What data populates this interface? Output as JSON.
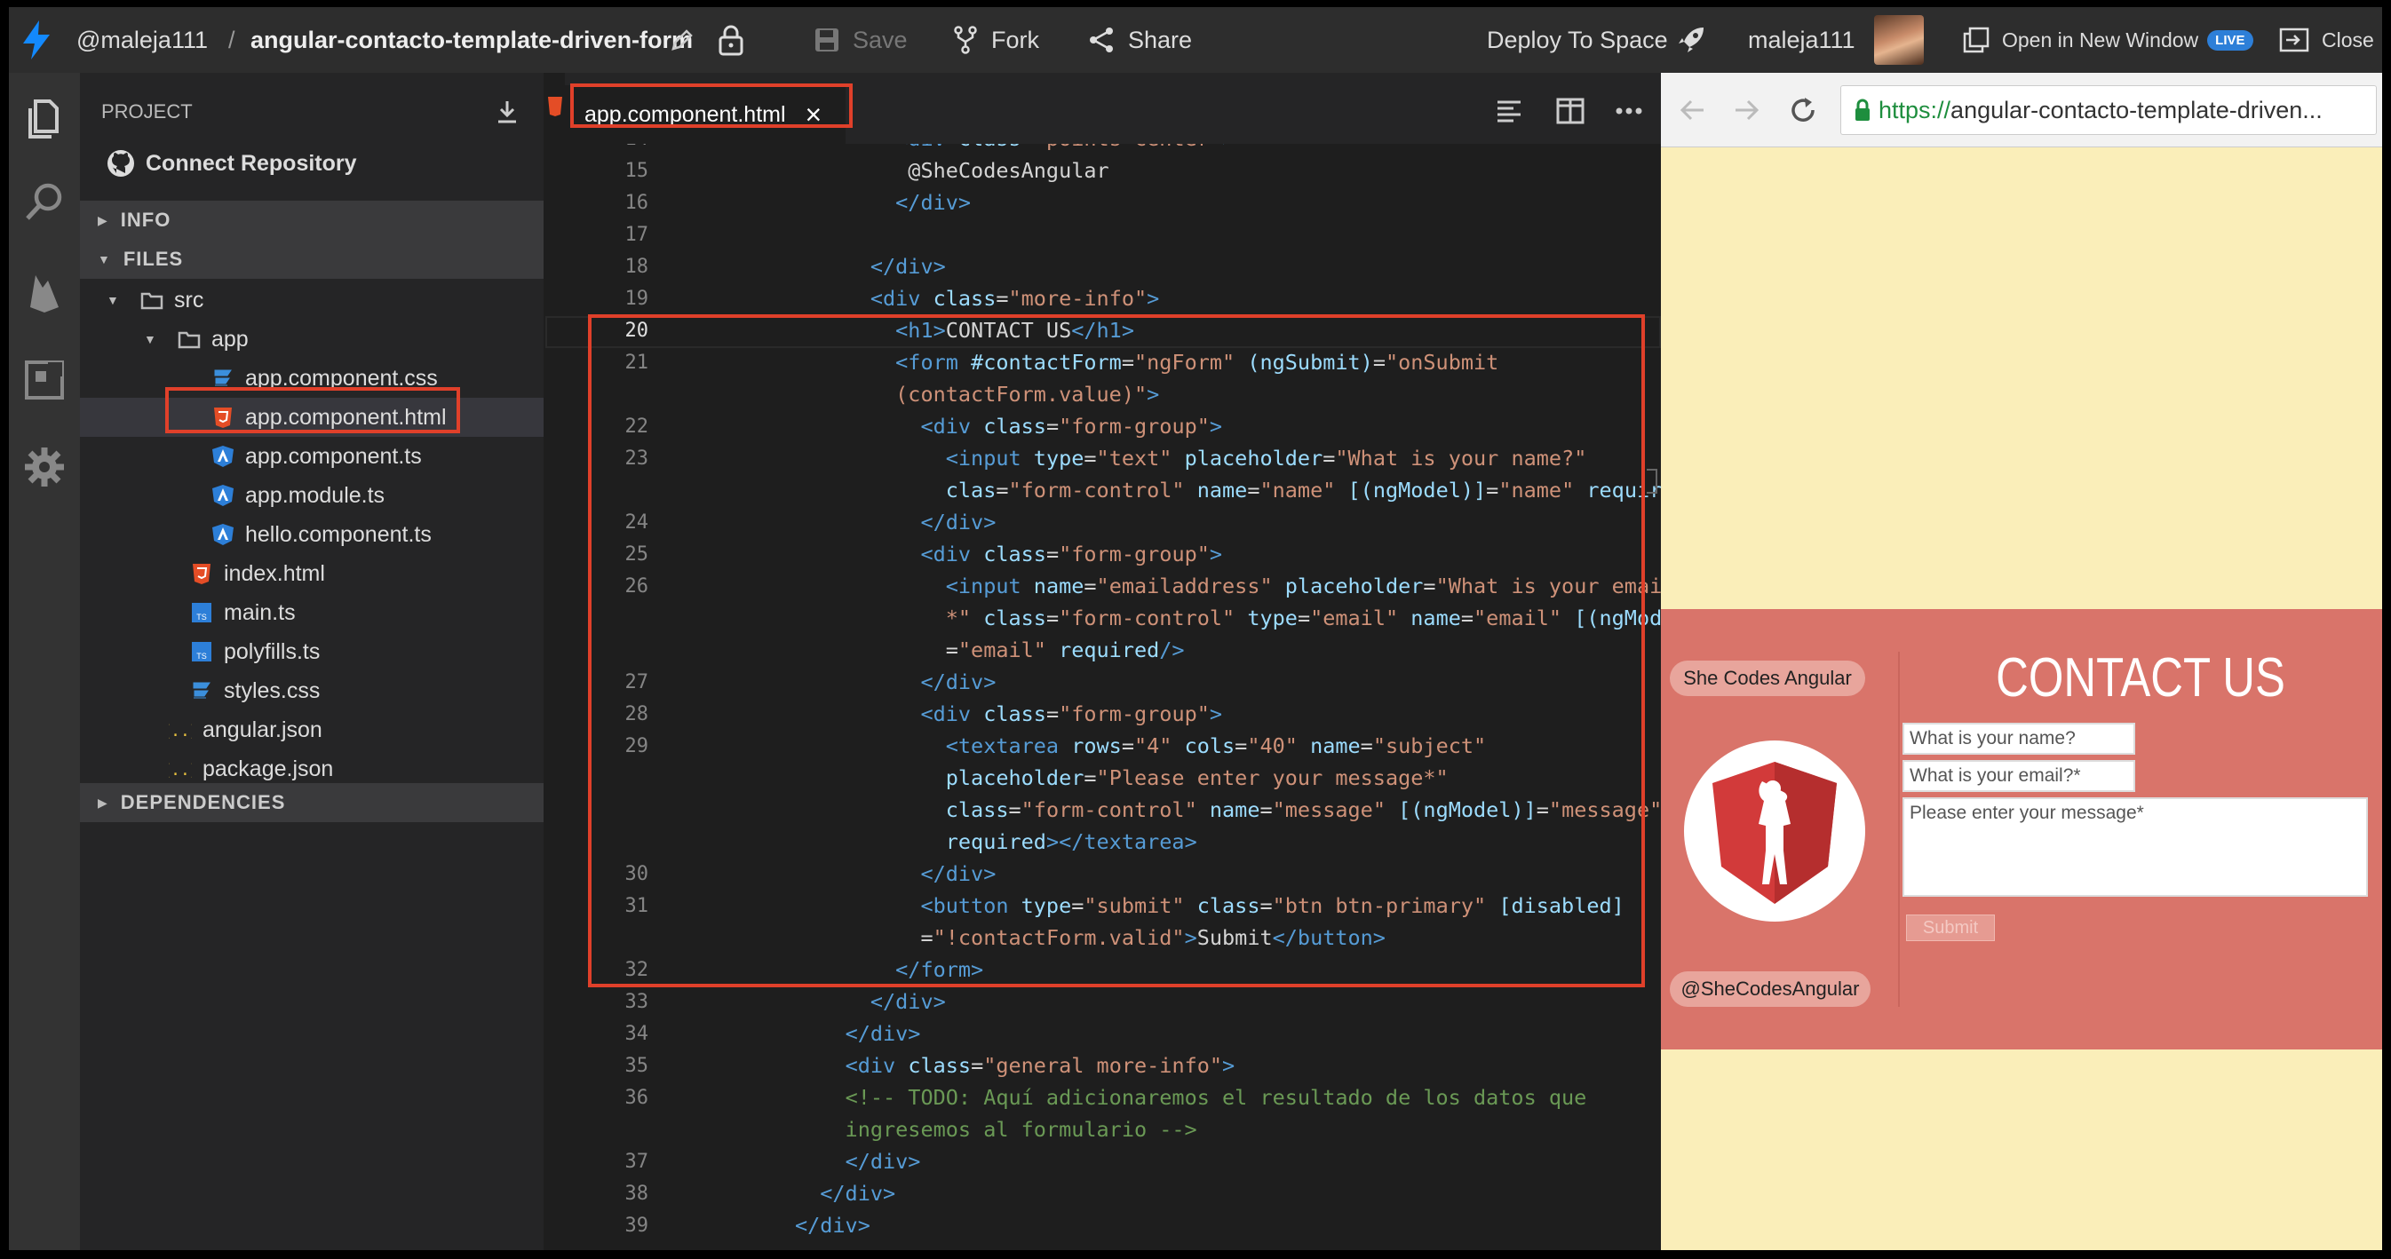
{
  "topbar": {
    "user": "@maleja111",
    "separator": "/",
    "project": "angular-contacto-template-driven-form",
    "save": "Save",
    "fork": "Fork",
    "share": "Share",
    "deploy": "Deploy To Space",
    "username": "maleja111",
    "open_new_window": "Open in New Window",
    "live_badge": "LIVE",
    "close": "Close"
  },
  "sidebar": {
    "project_label": "PROJECT",
    "connect_repo": "Connect Repository",
    "info": "INFO",
    "files": "FILES",
    "dependencies": "DEPENDENCIES",
    "tree": [
      {
        "name": "src",
        "icon": "folder-icon"
      },
      {
        "name": "app",
        "icon": "folder-icon"
      },
      {
        "name": "app.component.css",
        "icon": "css-icon"
      },
      {
        "name": "app.component.html",
        "icon": "html-icon"
      },
      {
        "name": "app.component.ts",
        "icon": "angular-icon"
      },
      {
        "name": "app.module.ts",
        "icon": "angular-icon"
      },
      {
        "name": "hello.component.ts",
        "icon": "angular-icon"
      },
      {
        "name": "index.html",
        "icon": "html-icon"
      },
      {
        "name": "main.ts",
        "icon": "ts-icon"
      },
      {
        "name": "polyfills.ts",
        "icon": "ts-icon"
      },
      {
        "name": "styles.css",
        "icon": "css-icon"
      },
      {
        "name": "angular.json",
        "icon": "json-icon"
      },
      {
        "name": "package.json",
        "icon": "json-icon"
      }
    ]
  },
  "editor": {
    "tab_label": "app.component.html",
    "tab_close": "×",
    "lines": [
      {
        "n": "14",
        "y": 0,
        "tokens": [
          [
            "pl",
            "                  "
          ],
          [
            "tg",
            "<div "
          ],
          [
            "at",
            "class"
          ],
          [
            "pl",
            "="
          ],
          [
            "st",
            "\"points-center\""
          ],
          [
            "tg",
            ">"
          ]
        ]
      },
      {
        "n": "15",
        "tokens": [
          [
            "pl",
            "                   @SheCodesAngular"
          ]
        ]
      },
      {
        "n": "16",
        "tokens": [
          [
            "pl",
            "                  "
          ],
          [
            "tg",
            "</div>"
          ]
        ]
      },
      {
        "n": "17",
        "tokens": [
          [
            "pl",
            ""
          ]
        ]
      },
      {
        "n": "18",
        "tokens": [
          [
            "pl",
            "                "
          ],
          [
            "tg",
            "</div>"
          ]
        ]
      },
      {
        "n": "19",
        "tokens": [
          [
            "pl",
            "                "
          ],
          [
            "tg",
            "<div "
          ],
          [
            "at",
            "class"
          ],
          [
            "pl",
            "="
          ],
          [
            "st",
            "\"more-info\""
          ],
          [
            "tg",
            ">"
          ]
        ]
      },
      {
        "n": "20",
        "cur": true,
        "tokens": [
          [
            "pl",
            "                  "
          ],
          [
            "tg",
            "<h1>"
          ],
          [
            "pl",
            "CONTACT US"
          ],
          [
            "tg",
            "</h1>"
          ]
        ]
      },
      {
        "n": "21",
        "tokens": [
          [
            "pl",
            "                  "
          ],
          [
            "tg",
            "<form "
          ],
          [
            "at",
            "#contactForm"
          ],
          [
            "pl",
            "="
          ],
          [
            "st",
            "\"ngForm\" "
          ],
          [
            "at",
            "(ngSubmit)"
          ],
          [
            "pl",
            "="
          ],
          [
            "st",
            "\"onSubmit"
          ]
        ]
      },
      {
        "n": "",
        "tokens": [
          [
            "st",
            "                  (contactForm.value)\""
          ],
          [
            "tg",
            ">"
          ]
        ]
      },
      {
        "n": "22",
        "tokens": [
          [
            "pl",
            "                    "
          ],
          [
            "tg",
            "<div "
          ],
          [
            "at",
            "class"
          ],
          [
            "pl",
            "="
          ],
          [
            "st",
            "\"form-group\""
          ],
          [
            "tg",
            ">"
          ]
        ]
      },
      {
        "n": "23",
        "tokens": [
          [
            "pl",
            "                      "
          ],
          [
            "tg",
            "<input "
          ],
          [
            "at",
            "type"
          ],
          [
            "pl",
            "="
          ],
          [
            "st",
            "\"text\" "
          ],
          [
            "at",
            "placeholder"
          ],
          [
            "pl",
            "="
          ],
          [
            "st",
            "\"What is your name?\""
          ]
        ]
      },
      {
        "n": "",
        "tokens": [
          [
            "pl",
            "                      "
          ],
          [
            "at",
            "clas"
          ],
          [
            "pl",
            "="
          ],
          [
            "st",
            "\"form-control\" "
          ],
          [
            "at",
            "name"
          ],
          [
            "pl",
            "="
          ],
          [
            "st",
            "\"name\" "
          ],
          [
            "at",
            "[(ngModel)]"
          ],
          [
            "pl",
            "="
          ],
          [
            "st",
            "\"name\" "
          ],
          [
            "at",
            "required"
          ],
          [
            "tg",
            "/>"
          ]
        ]
      },
      {
        "n": "24",
        "tokens": [
          [
            "pl",
            "                    "
          ],
          [
            "tg",
            "</div>"
          ]
        ]
      },
      {
        "n": "25",
        "tokens": [
          [
            "pl",
            "                    "
          ],
          [
            "tg",
            "<div "
          ],
          [
            "at",
            "class"
          ],
          [
            "pl",
            "="
          ],
          [
            "st",
            "\"form-group\""
          ],
          [
            "tg",
            ">"
          ]
        ]
      },
      {
        "n": "26",
        "tokens": [
          [
            "pl",
            "                      "
          ],
          [
            "tg",
            "<input "
          ],
          [
            "at",
            "name"
          ],
          [
            "pl",
            "="
          ],
          [
            "st",
            "\"emailaddress\" "
          ],
          [
            "at",
            "placeholder"
          ],
          [
            "pl",
            "="
          ],
          [
            "st",
            "\"What is your email?"
          ]
        ]
      },
      {
        "n": "",
        "tokens": [
          [
            "st",
            "                      *\" "
          ],
          [
            "at",
            "class"
          ],
          [
            "pl",
            "="
          ],
          [
            "st",
            "\"form-control\" "
          ],
          [
            "at",
            "type"
          ],
          [
            "pl",
            "="
          ],
          [
            "st",
            "\"email\" "
          ],
          [
            "at",
            "name"
          ],
          [
            "pl",
            "="
          ],
          [
            "st",
            "\"email\" "
          ],
          [
            "at",
            "[(ngModel)]"
          ]
        ]
      },
      {
        "n": "",
        "tokens": [
          [
            "pl",
            "                      ="
          ],
          [
            "st",
            "\"email\" "
          ],
          [
            "at",
            "required"
          ],
          [
            "tg",
            "/>"
          ]
        ]
      },
      {
        "n": "27",
        "tokens": [
          [
            "pl",
            "                    "
          ],
          [
            "tg",
            "</div>"
          ]
        ]
      },
      {
        "n": "28",
        "tokens": [
          [
            "pl",
            "                    "
          ],
          [
            "tg",
            "<div "
          ],
          [
            "at",
            "class"
          ],
          [
            "pl",
            "="
          ],
          [
            "st",
            "\"form-group\""
          ],
          [
            "tg",
            ">"
          ]
        ]
      },
      {
        "n": "29",
        "tokens": [
          [
            "pl",
            "                      "
          ],
          [
            "tg",
            "<textarea "
          ],
          [
            "at",
            "rows"
          ],
          [
            "pl",
            "="
          ],
          [
            "st",
            "\"4\" "
          ],
          [
            "at",
            "cols"
          ],
          [
            "pl",
            "="
          ],
          [
            "st",
            "\"40\" "
          ],
          [
            "at",
            "name"
          ],
          [
            "pl",
            "="
          ],
          [
            "st",
            "\"subject\""
          ]
        ]
      },
      {
        "n": "",
        "tokens": [
          [
            "pl",
            "                      "
          ],
          [
            "at",
            "placeholder"
          ],
          [
            "pl",
            "="
          ],
          [
            "st",
            "\"Please enter your message*\""
          ]
        ]
      },
      {
        "n": "",
        "tokens": [
          [
            "pl",
            "                      "
          ],
          [
            "at",
            "class"
          ],
          [
            "pl",
            "="
          ],
          [
            "st",
            "\"form-control\" "
          ],
          [
            "at",
            "name"
          ],
          [
            "pl",
            "="
          ],
          [
            "st",
            "\"message\" "
          ],
          [
            "at",
            "[(ngModel)]"
          ],
          [
            "pl",
            "="
          ],
          [
            "st",
            "\"message\""
          ]
        ]
      },
      {
        "n": "",
        "tokens": [
          [
            "pl",
            "                      "
          ],
          [
            "at",
            "required"
          ],
          [
            "tg",
            "></textarea>"
          ]
        ]
      },
      {
        "n": "30",
        "tokens": [
          [
            "pl",
            "                    "
          ],
          [
            "tg",
            "</div>"
          ]
        ]
      },
      {
        "n": "31",
        "tokens": [
          [
            "pl",
            "                    "
          ],
          [
            "tg",
            "<button "
          ],
          [
            "at",
            "type"
          ],
          [
            "pl",
            "="
          ],
          [
            "st",
            "\"submit\" "
          ],
          [
            "at",
            "class"
          ],
          [
            "pl",
            "="
          ],
          [
            "st",
            "\"btn btn-primary\" "
          ],
          [
            "at",
            "[disabled]"
          ]
        ]
      },
      {
        "n": "",
        "tokens": [
          [
            "pl",
            "                    ="
          ],
          [
            "st",
            "\"!contactForm.valid\""
          ],
          [
            "tg",
            ">"
          ],
          [
            "pl",
            "Submit"
          ],
          [
            "tg",
            "</button>"
          ]
        ]
      },
      {
        "n": "32",
        "tokens": [
          [
            "pl",
            "                  "
          ],
          [
            "tg",
            "</form>"
          ]
        ]
      },
      {
        "n": "33",
        "tokens": [
          [
            "pl",
            "                "
          ],
          [
            "tg",
            "</div>"
          ]
        ]
      },
      {
        "n": "34",
        "tokens": [
          [
            "pl",
            "              "
          ],
          [
            "tg",
            "</div>"
          ]
        ]
      },
      {
        "n": "35",
        "tokens": [
          [
            "pl",
            "              "
          ],
          [
            "tg",
            "<div "
          ],
          [
            "at",
            "class"
          ],
          [
            "pl",
            "="
          ],
          [
            "st",
            "\"general more-info\""
          ],
          [
            "tg",
            ">"
          ]
        ]
      },
      {
        "n": "36",
        "tokens": [
          [
            "pl",
            "              "
          ],
          [
            "cm",
            "<!-- TODO: Aquí adicionaremos el resultado de los datos que"
          ]
        ]
      },
      {
        "n": "",
        "tokens": [
          [
            "cm",
            "              ingresemos al formulario -->"
          ]
        ]
      },
      {
        "n": "37",
        "tokens": [
          [
            "pl",
            "              "
          ],
          [
            "tg",
            "</div>"
          ]
        ]
      },
      {
        "n": "38",
        "tokens": [
          [
            "pl",
            "            "
          ],
          [
            "tg",
            "</div>"
          ]
        ]
      },
      {
        "n": "39",
        "tokens": [
          [
            "pl",
            "          "
          ],
          [
            "tg",
            "</div>"
          ]
        ]
      }
    ]
  },
  "preview": {
    "url_scheme": "https://",
    "url_rest": "angular-contacto-template-driven...",
    "brand": "She Codes Angular",
    "handle": "@SheCodesAngular",
    "heading": "CONTACT US",
    "name_placeholder": "What is your name?",
    "email_placeholder": "What is your email?*",
    "message_placeholder": "Please enter your message*",
    "submit": "Submit"
  },
  "colors": {
    "highlight": "#e0402a",
    "accent_blue": "#2d7fd8",
    "hero": "#d9746a",
    "preview_bg": "#faeeb9"
  }
}
